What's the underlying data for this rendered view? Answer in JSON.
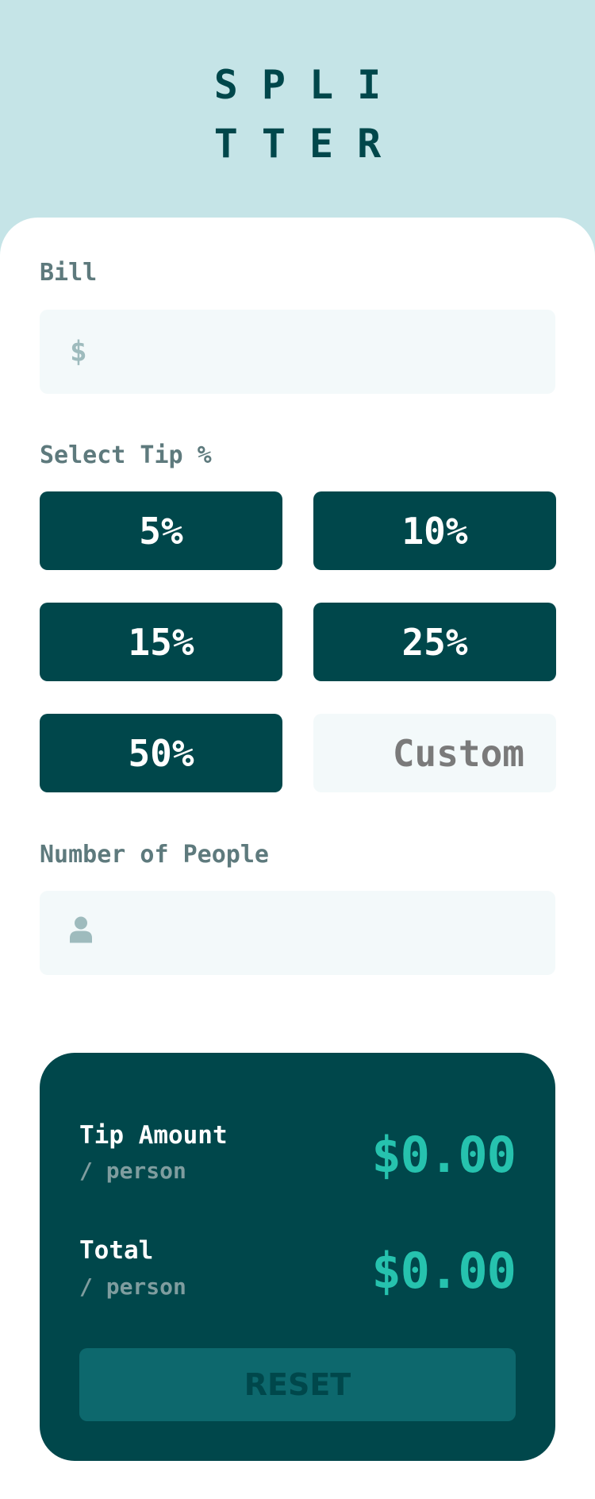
{
  "app": {
    "logo_line1": "SPLI",
    "logo_line2": "TTER"
  },
  "bill": {
    "label": "Bill",
    "currency_symbol": "$",
    "value": ""
  },
  "tip": {
    "label": "Select Tip %",
    "options": [
      "5%",
      "10%",
      "15%",
      "25%",
      "50%"
    ],
    "custom_placeholder": "Custom"
  },
  "people": {
    "label": "Number of People",
    "icon": "person-icon",
    "value": ""
  },
  "results": {
    "tip_amount_title": "Tip Amount",
    "tip_amount_sub": "/ person",
    "tip_amount_value": "$0.00",
    "total_title": "Total",
    "total_sub": "/ person",
    "total_value": "$0.00",
    "reset_label": "RESET"
  },
  "colors": {
    "background": "#c5e4e7",
    "dark_cyan": "#00474b",
    "accent": "#26c2ae",
    "input_bg": "#f3f9fa"
  }
}
